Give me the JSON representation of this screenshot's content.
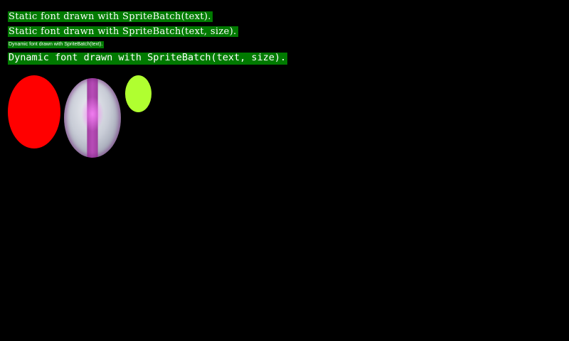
{
  "labels": {
    "line1": "Static font drawn with SpriteBatch(text).",
    "line2": "Static font drawn with SpriteBatch(text, size).",
    "line3": "Dynamic font drawn with SpriteBatch(text).",
    "line4": "Dynamic font drawn with SpriteBatch(text, size)."
  },
  "colors": {
    "background": "#000000",
    "label_bg": "#007a00",
    "label_text": "#ffffff",
    "red_sprite": "#ff0000",
    "ball_stripe": "#a040a0",
    "lime_sprite": "#b0ff30"
  }
}
